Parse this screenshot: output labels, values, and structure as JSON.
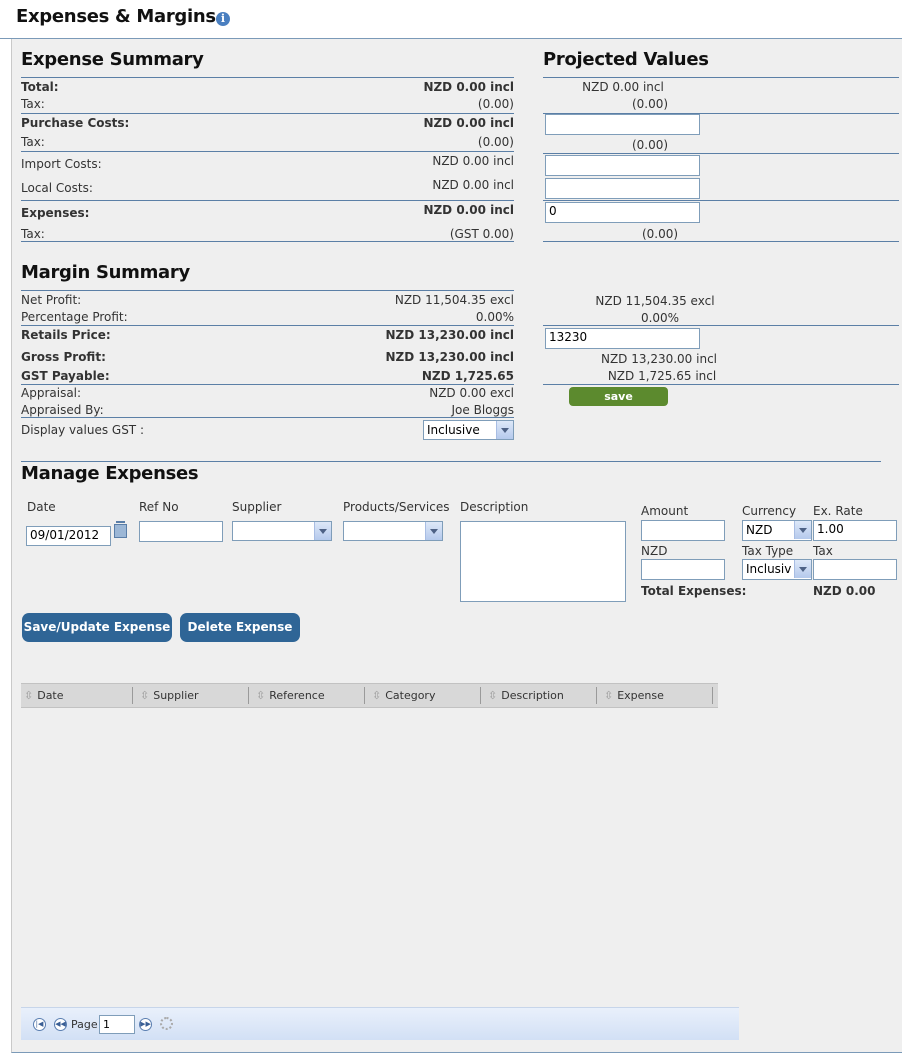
{
  "page": {
    "title": "Expenses & Margins"
  },
  "expense_summary": {
    "heading": "Expense Summary",
    "rows": [
      {
        "label": "Total:",
        "value": "NZD 0.00 incl"
      },
      {
        "label": "Tax:",
        "value": "(0.00)"
      },
      {
        "label": "Purchase Costs:",
        "value": "NZD 0.00 incl"
      },
      {
        "label": "Tax:",
        "value": "(0.00)"
      },
      {
        "label": "Import Costs:",
        "value": "NZD 0.00 incl"
      },
      {
        "label": "Local Costs:",
        "value": "NZD 0.00 incl"
      },
      {
        "label": "Expenses:",
        "value": "NZD 0.00 incl"
      },
      {
        "label": "Tax:",
        "value": "(GST 0.00)"
      }
    ]
  },
  "projected": {
    "heading": "Projected Values",
    "total": "NZD 0.00 incl",
    "total_tax": "(0.00)",
    "purchase_value": "",
    "purchase_tax": "(0.00)",
    "import_value": "",
    "local_value": "",
    "expenses_value": "0",
    "expenses_tax": "(0.00)",
    "net_profit": "NZD 11,504.35 excl",
    "percentage_profit": "0.00%",
    "retail_price_value": "13230",
    "gross_profit": "NZD 13,230.00 incl",
    "gst_payable": "NZD 1,725.65 incl",
    "save_label": "save"
  },
  "margin_summary": {
    "heading": "Margin Summary",
    "rows": [
      {
        "label": "Net Profit:",
        "value": "NZD 11,504.35 excl"
      },
      {
        "label": "Percentage Profit:",
        "value": "0.00%"
      },
      {
        "label": "Retails Price:",
        "value": "NZD 13,230.00 incl"
      },
      {
        "label": "Gross Profit:",
        "value": "NZD 13,230.00 incl"
      },
      {
        "label": "GST Payable:",
        "value": "NZD 1,725.65"
      },
      {
        "label": "Appraisal:",
        "value": "NZD 0.00 excl"
      },
      {
        "label": "Appraised By:",
        "value": "Joe Bloggs"
      },
      {
        "label": "Display values GST :",
        "value": "Inclusive"
      }
    ]
  },
  "manage": {
    "heading": "Manage Expenses",
    "date_label": "Date",
    "date_value": "09/01/2012",
    "ref_label": "Ref No",
    "supplier_label": "Supplier",
    "products_label": "Products/Services",
    "description_label": "Description",
    "amount_label": "Amount",
    "currency_label": "Currency",
    "currency_value": "NZD",
    "rate_label": "Ex. Rate",
    "rate_value": "1.00",
    "nzd_label": "NZD",
    "tax_type_label": "Tax Type",
    "tax_type_value": "Inclusiv",
    "tax_label": "Tax",
    "total_label": "Total Expenses:",
    "total_value": "NZD 0.00",
    "save_update_label": "Save/Update Expense",
    "delete_label": "Delete Expense"
  },
  "grid": {
    "columns": [
      "Date",
      "Supplier",
      "Reference",
      "Category",
      "Description",
      "Expense"
    ],
    "page_label": "Page",
    "page_value": "1"
  }
}
